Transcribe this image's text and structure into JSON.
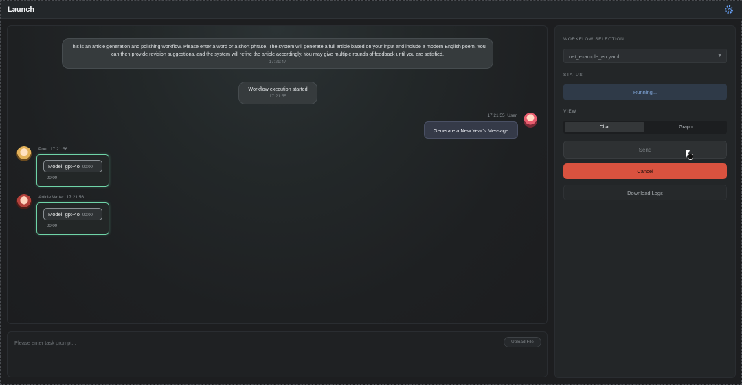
{
  "window": {
    "title": "Launch",
    "settings_icon": "gear-icon"
  },
  "chat": {
    "intro": {
      "text": "This is an article generation and polishing workflow. Please enter a word or a short phrase. The system will generate a full article based on your input and include a modern English poem. You can then provide revision suggestions, and the system will refine the article accordingly. You may give multiple rounds of feedback until you are satisfied.",
      "time": "17:21:47"
    },
    "system": {
      "text": "Workflow execution started",
      "time": "17:21:55"
    },
    "user": {
      "time": "17:21:55",
      "name": "User",
      "text": "Generate a New Year's Message"
    },
    "agents": [
      {
        "name": "Poet",
        "time": "17:21:56",
        "model": "Model: gpt-4o",
        "timer": "00:00",
        "elapsed": "00:00"
      },
      {
        "name": "Article Writer",
        "time": "17:21:56",
        "model": "Model: gpt-4o",
        "timer": "00:00",
        "elapsed": "00:00"
      }
    ]
  },
  "input": {
    "placeholder": "Please enter task prompt...",
    "upload_label": "Upload File"
  },
  "sidebar": {
    "workflow_label": "WORKFLOW SELECTION",
    "workflow_value": "net_example_en.yaml",
    "status_label": "STATUS",
    "status_value": "Running...",
    "view_label": "VIEW",
    "view_tabs": [
      "Chat",
      "Graph"
    ],
    "send_label": "Send",
    "cancel_label": "Cancel",
    "download_label": "Download Logs"
  },
  "colors": {
    "accent_cancel": "#d9523f",
    "status_text": "#7fa4d6",
    "agent_border": "#6fd4a8"
  }
}
